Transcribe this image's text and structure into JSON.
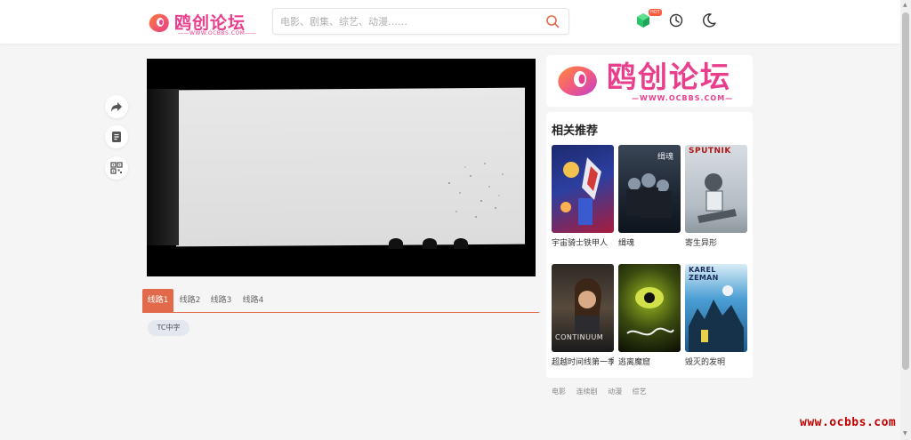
{
  "header": {
    "logo_text": "鸥创论坛",
    "logo_domain": "——WWW.OCBBS.COM——",
    "search_placeholder": "电影、剧集、综艺、动漫……",
    "badge": "HOT"
  },
  "player": {
    "routes": [
      "线路1",
      "线路2",
      "线路3",
      "线路4"
    ],
    "active_route": "线路1",
    "episode": "TC中字"
  },
  "banner": {
    "logo_text": "鸥创论坛",
    "logo_domain": "—WWW.OCBBS.COM—"
  },
  "recommend": {
    "title": "相关推荐",
    "items": [
      {
        "title": "宇宙骑士铁甲人"
      },
      {
        "title": "缉魂"
      },
      {
        "title": "寄生异形",
        "poster_text": "SPUTNIK"
      },
      {
        "title": "超越时间线第一季",
        "poster_text": "CONTINUUM"
      },
      {
        "title": "逃离魔窟"
      },
      {
        "title": "毁灭的发明",
        "poster_text": "KAREL ZEMAN"
      }
    ]
  },
  "footer": {
    "links": [
      "电影",
      "连续剧",
      "动漫",
      "综艺"
    ]
  },
  "watermark": "www.ocbbs.com",
  "colors": {
    "accent": "#e26a4a",
    "brand": "#e83e8c",
    "watermark": "#c00000"
  }
}
